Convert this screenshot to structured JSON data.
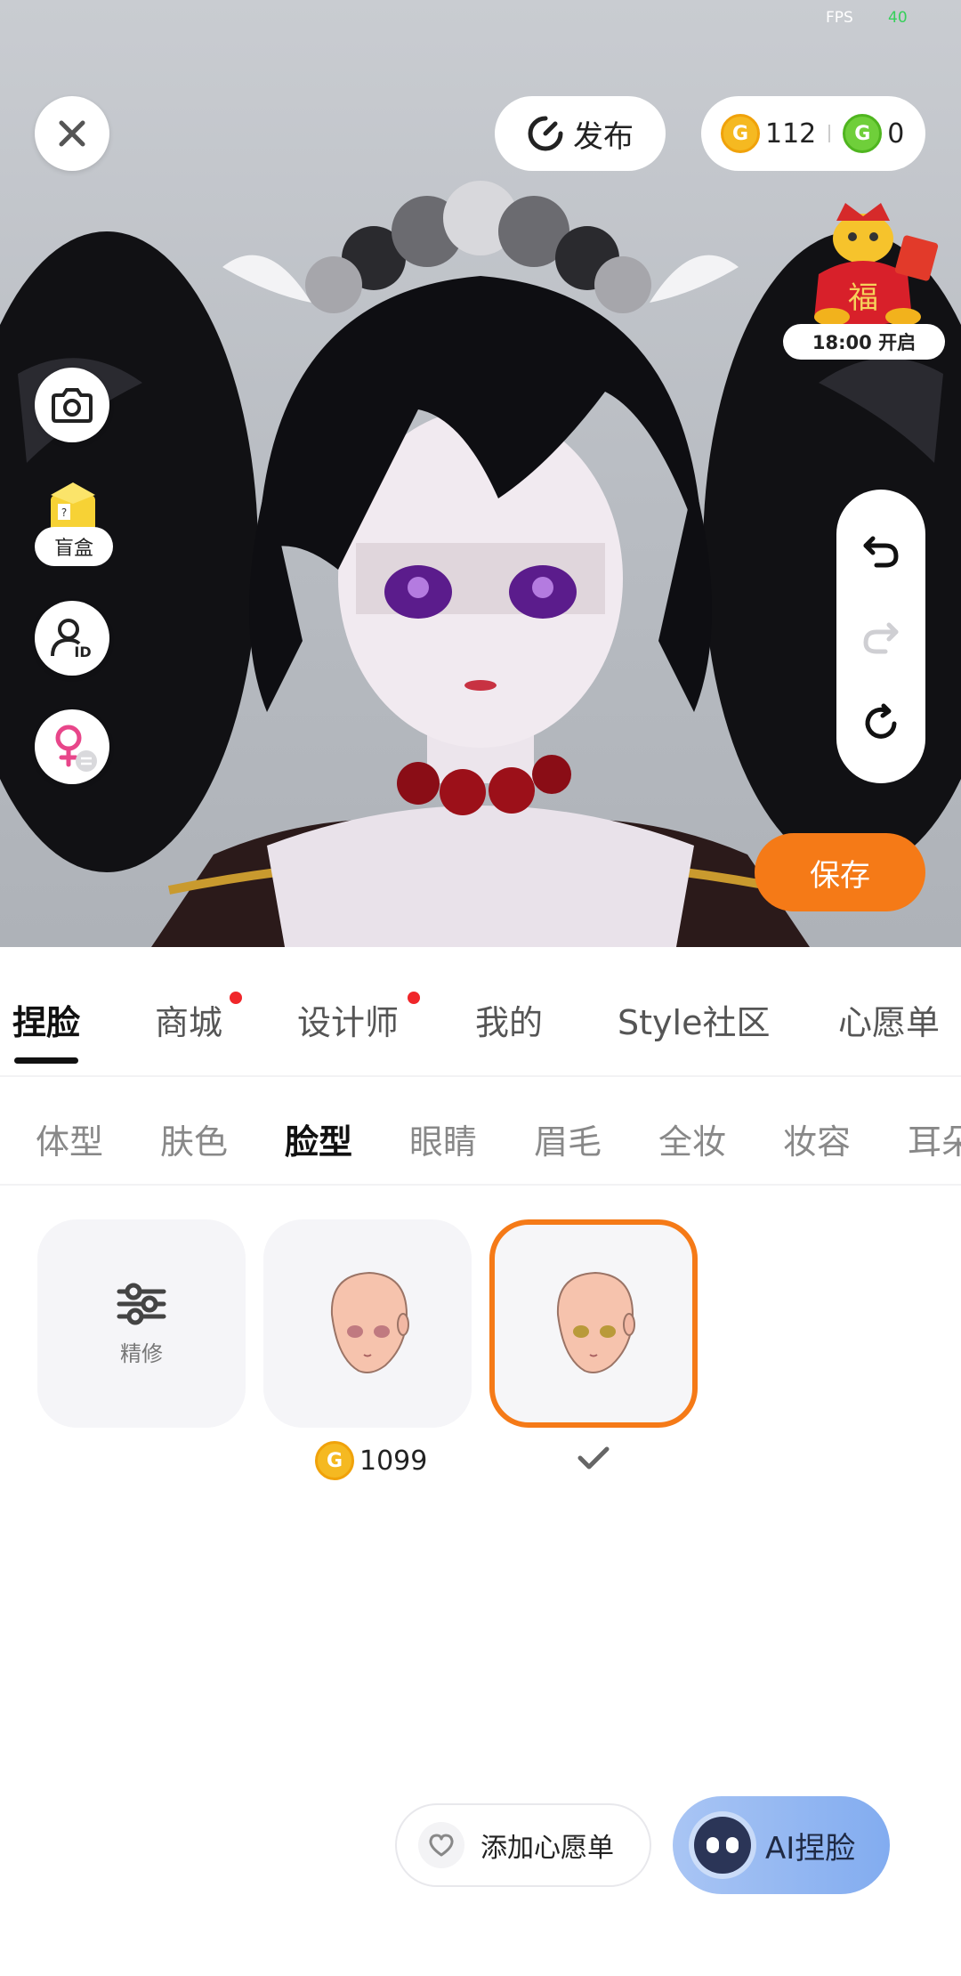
{
  "status": {
    "fps_label": "FPS",
    "fps_value": "40"
  },
  "toolbar": {
    "publish_label": "发布",
    "gold_coins": "112",
    "green_coins": "0",
    "coin_gold_symbol": "G",
    "coin_green_symbol": "G"
  },
  "event": {
    "time_label": "18:00 开启",
    "badge_char": "福"
  },
  "side": {
    "blindbox_label": "盲盒",
    "id_label": "ID"
  },
  "save_label": "保存",
  "main_tabs": [
    {
      "label": "捏脸",
      "active": true
    },
    {
      "label": "商城",
      "badge": true
    },
    {
      "label": "设计师",
      "badge": true
    },
    {
      "label": "我的"
    },
    {
      "label": "Style社区"
    },
    {
      "label": "心愿单"
    }
  ],
  "sub_tabs": [
    "体型",
    "肤色",
    "脸型",
    "眼睛",
    "眉毛",
    "全妆",
    "妆容",
    "耳朵"
  ],
  "sub_tab_active": "脸型",
  "cards": {
    "refine_label": "精修",
    "price_value": "1099"
  },
  "bottom": {
    "wishlist_label": "添加心愿单",
    "ai_label": "AI捏脸"
  },
  "colors": {
    "accent": "#f57a17",
    "red_dot": "#f0262a",
    "gold": "#f5b921",
    "green": "#6fcf3a"
  }
}
